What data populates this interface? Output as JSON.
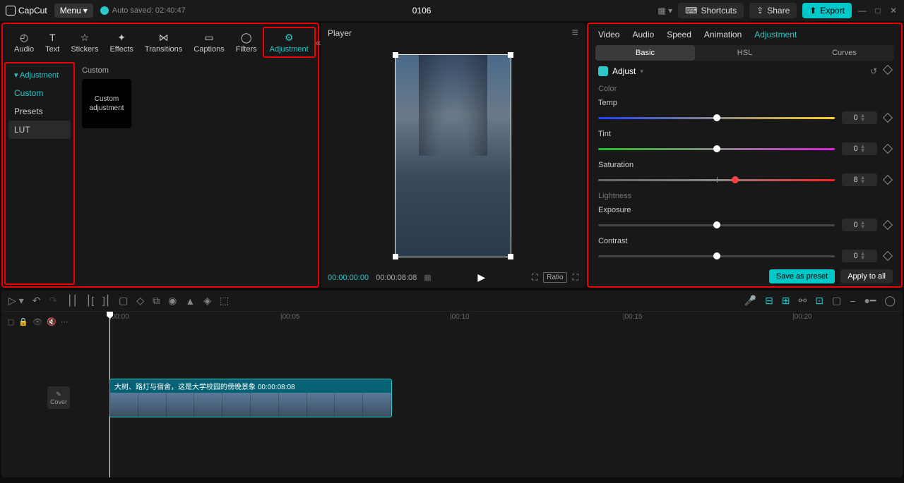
{
  "app": {
    "name": "CapCut"
  },
  "menu": {
    "label": "Menu"
  },
  "autosave": {
    "text": "Auto saved: 02:40:47"
  },
  "project": {
    "title": "0106"
  },
  "topbar": {
    "shortcuts": "Shortcuts",
    "share": "Share",
    "export": "Export"
  },
  "tool_tabs": [
    {
      "label": "Audio"
    },
    {
      "label": "Text"
    },
    {
      "label": "Stickers"
    },
    {
      "label": "Effects"
    },
    {
      "label": "Transitions"
    },
    {
      "label": "Captions"
    },
    {
      "label": "Filters"
    },
    {
      "label": "Adjustment"
    }
  ],
  "sidebar": {
    "header": "Adjustment",
    "items": [
      "Custom",
      "Presets",
      "LUT"
    ]
  },
  "thumbs": {
    "section": "Custom",
    "item0": "Custom adjustment"
  },
  "player": {
    "title": "Player",
    "time_current": "00:00:00:00",
    "time_duration": "00:00:08:08",
    "ratio_label": "Ratio"
  },
  "props": {
    "tabs": [
      "Video",
      "Audio",
      "Speed",
      "Animation",
      "Adjustment"
    ],
    "sub_tabs": [
      "Basic",
      "HSL",
      "Curves"
    ],
    "adjust_label": "Adjust",
    "section_color": "Color",
    "section_lightness": "Lightness",
    "sliders": {
      "temp": {
        "label": "Temp",
        "value": "0",
        "pos": 50
      },
      "tint": {
        "label": "Tint",
        "value": "0",
        "pos": 50
      },
      "saturation": {
        "label": "Saturation",
        "value": "8",
        "pos": 58
      },
      "exposure": {
        "label": "Exposure",
        "value": "0",
        "pos": 50
      },
      "contrast": {
        "label": "Contrast",
        "value": "0",
        "pos": 50
      }
    },
    "save_preset": "Save as preset",
    "apply_all": "Apply to all"
  },
  "timeline": {
    "cover": "Cover",
    "marks": [
      "|00:00",
      "|00:05",
      "|00:10",
      "|00:15",
      "|00:20"
    ],
    "clip_label": "大树、路灯与宿舍，这是大学校园的傍晚景象   00:00:08:08"
  }
}
